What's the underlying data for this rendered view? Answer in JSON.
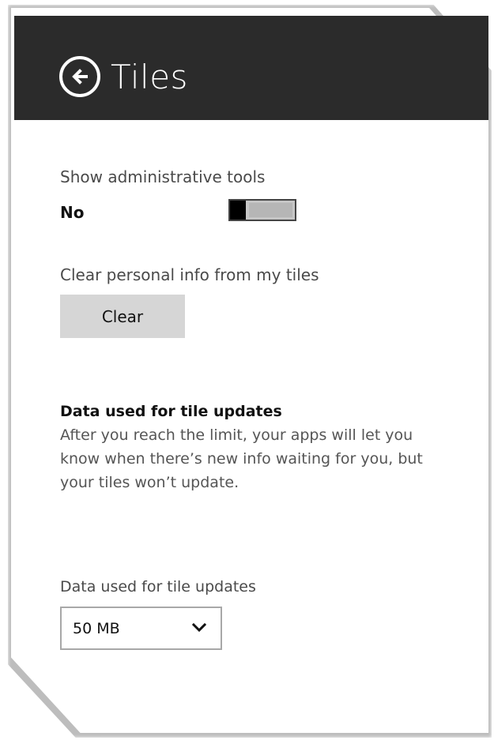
{
  "header": {
    "title": "Tiles",
    "back_icon": "back-arrow-circle-icon"
  },
  "admin_tools": {
    "label": "Show administrative tools",
    "state": "No",
    "enabled": false
  },
  "clear_info": {
    "label": "Clear personal info from my tiles",
    "button_label": "Clear"
  },
  "tile_updates": {
    "heading": "Data used for tile updates",
    "description": "After you reach the limit, your apps will let you know when there’s new info waiting for you, but your tiles won’t update."
  },
  "data_limit": {
    "label": "Data used for tile updates",
    "selected": "50 MB",
    "icon": "chevron-down-icon"
  },
  "colors": {
    "header_bg": "#2b2b2b",
    "button_bg": "#d6d6d6",
    "toggle_off": "#c6c6c6"
  }
}
